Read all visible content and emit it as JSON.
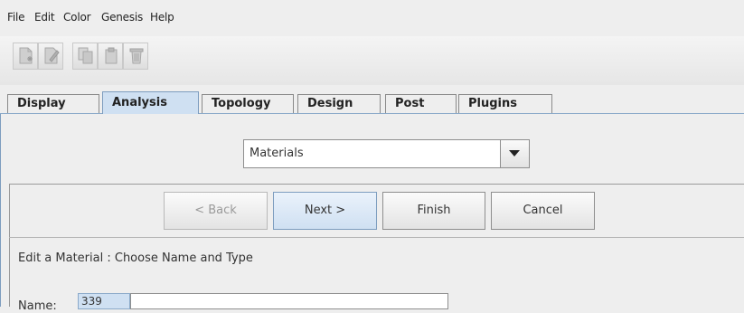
{
  "menu": [
    "File",
    "Edit",
    "Color",
    "Genesis",
    "Help"
  ],
  "toolbar": {
    "buttons": [
      "new-document-icon",
      "edit-document-icon",
      "copy-icon",
      "paste-icon",
      "delete-icon"
    ]
  },
  "tabs": {
    "items": [
      "Display",
      "Analysis",
      "Topology",
      "Design",
      "Post",
      "Plugins"
    ],
    "active": "Analysis"
  },
  "combo": {
    "value": "Materials"
  },
  "wizard": {
    "back_label": "< Back",
    "next_label": "Next >",
    "finish_label": "Finish",
    "cancel_label": "Cancel",
    "step_title": "Edit a Material : Choose Name and Type",
    "name_label": "Name:",
    "name_id": "339",
    "name_value": ""
  }
}
